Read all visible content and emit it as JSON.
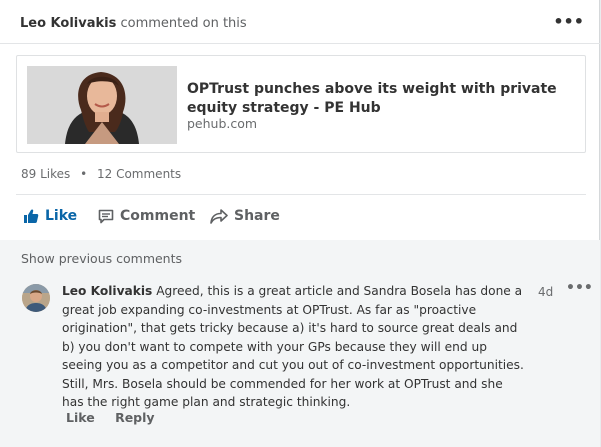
{
  "header": {
    "actor_name": "Leo Kolivakis",
    "action_text": "commented on this",
    "more_glyph": "•••"
  },
  "shared_article": {
    "title": "OPTrust punches above its weight with private equity strategy - PE Hub",
    "source": "pehub.com",
    "thumbnail_icon": "person-photo"
  },
  "social_counts": {
    "likes": "89 Likes",
    "separator": "•",
    "comments": "12 Comments"
  },
  "actions": {
    "like": "Like",
    "comment": "Comment",
    "share": "Share"
  },
  "comments_section": {
    "show_previous": "Show previous comments",
    "comment": {
      "author": "Leo Kolivakis",
      "text": "Agreed,  this is a great article  and Sandra Bosela has done a great job expanding co-investments at OPTrust.  As far as \"proactive origination\", that gets tricky because a) it's hard to source great deals and b) you don't want to compete with your GPs because they will  end up seeing you as a competitor and cut you out of co-investment opportunities.  Still, Mrs. Bosela should be commended for her work at OPTrust and she has the right game plan and strategic thinking.",
      "time": "4d",
      "more_glyph": "•••",
      "like_label": "Like",
      "reply_label": "Reply"
    }
  },
  "colors": {
    "accent": "#0a66a8",
    "comments_bg": "#f3f5f6"
  }
}
